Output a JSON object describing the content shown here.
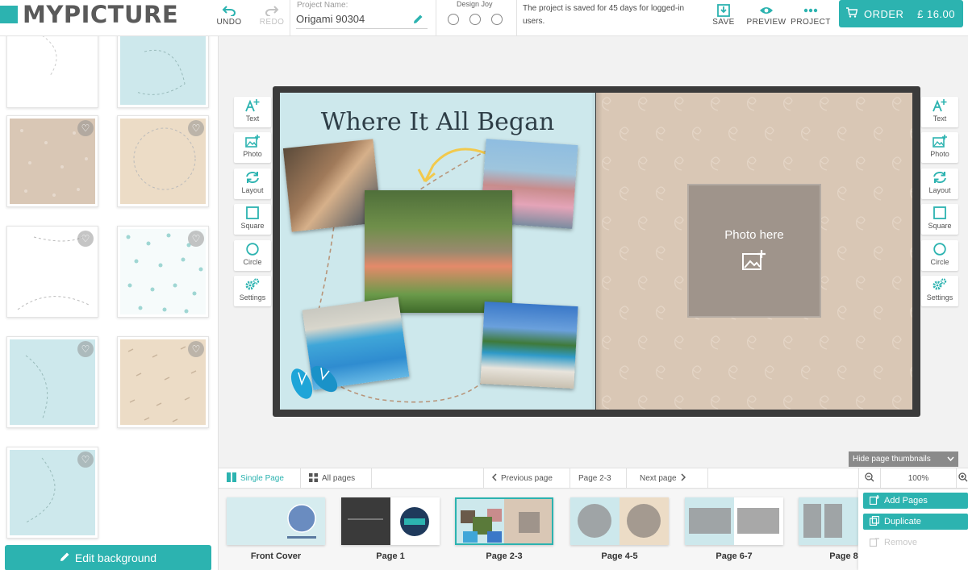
{
  "brand": {
    "logo_text": "MYPICTURE",
    "accent_color": "#2cb3b0"
  },
  "toolbar": {
    "undo_label": "UNDO",
    "redo_label": "REDO",
    "project_name_label": "Project Name:",
    "project_name_value": "Origami 90304",
    "design_joy_label": "Design Joy",
    "saved_message": "The project is saved for 45 days for logged-in users.",
    "save_label": "SAVE",
    "preview_label": "PREVIEW",
    "project_label": "PROJECT",
    "order_label": "ORDER",
    "order_price": "£ 16.00"
  },
  "left_panel": {
    "edit_background_label": "Edit background"
  },
  "tools_left": [
    {
      "label": "Text",
      "icon": "add-text-icon"
    },
    {
      "label": "Photo",
      "icon": "add-photo-icon"
    },
    {
      "label": "Layout",
      "icon": "layout-refresh-icon"
    },
    {
      "label": "Square",
      "icon": "square-icon"
    },
    {
      "label": "Circle",
      "icon": "circle-icon"
    },
    {
      "label": "Settings",
      "icon": "settings-gears-icon"
    }
  ],
  "tools_right": [
    {
      "label": "Text",
      "icon": "add-text-icon"
    },
    {
      "label": "Photo",
      "icon": "add-photo-icon"
    },
    {
      "label": "Layout",
      "icon": "layout-refresh-icon"
    },
    {
      "label": "Square",
      "icon": "square-icon"
    },
    {
      "label": "Circle",
      "icon": "circle-icon"
    },
    {
      "label": "Settings",
      "icon": "settings-gears-icon"
    }
  ],
  "spread": {
    "title": "Where It All Began",
    "photo_placeholder": "Photo here"
  },
  "bottom": {
    "hide_thumbnails_label": "Hide page thumbnails",
    "single_page_label": "Single Page",
    "all_pages_label": "All pages",
    "previous_page_label": "Previous page",
    "current_page_label": "Page 2-3",
    "next_page_label": "Next page",
    "zoom_value": "100%",
    "thumbnails": [
      {
        "label": "Front Cover"
      },
      {
        "label": "Page 1"
      },
      {
        "label": "Page 2-3"
      },
      {
        "label": "Page 4-5"
      },
      {
        "label": "Page 6-7"
      },
      {
        "label": "Page 8"
      }
    ],
    "menu": {
      "add_pages_label": "Add Pages",
      "duplicate_label": "Duplicate",
      "remove_label": "Remove"
    }
  }
}
